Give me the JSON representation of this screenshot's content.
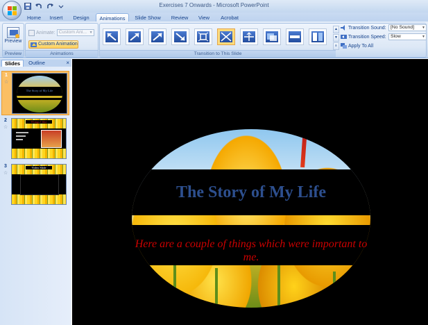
{
  "window": {
    "title": "Exercises 7 Onwards - Microsoft PowerPoint"
  },
  "tabs": [
    {
      "label": "Home",
      "active": false
    },
    {
      "label": "Insert",
      "active": false
    },
    {
      "label": "Design",
      "active": false
    },
    {
      "label": "Animations",
      "active": true
    },
    {
      "label": "Slide Show",
      "active": false
    },
    {
      "label": "Review",
      "active": false
    },
    {
      "label": "View",
      "active": false
    },
    {
      "label": "Acrobat",
      "active": false
    }
  ],
  "ribbon": {
    "preview": {
      "button_label": "Preview",
      "group_label": "Preview"
    },
    "animations": {
      "animate_label": "Animate:",
      "animate_value": "Custom Ani...",
      "custom_animation_label": "Custom Animation",
      "group_label": "Animations"
    },
    "transitions": {
      "group_label": "Transition to This Slide",
      "selected_index": 5,
      "thumb_icons": [
        "wipe-in-icon",
        "wipe-up-icon",
        "wipe-diagonal-icon",
        "push-icon",
        "box-in-icon",
        "box-out-icon",
        "split-icon",
        "cover-icon",
        "bar-icon",
        "split-vertical-icon"
      ],
      "sound_label": "Transition Sound:",
      "sound_value": "[No Sound]",
      "speed_label": "Transition Speed:",
      "speed_value": "Slow",
      "apply_all_label": "Apply To All"
    }
  },
  "left_pane": {
    "tab_slides": "Slides",
    "tab_outline": "Outline",
    "close": "×",
    "slides": [
      {
        "number": "1",
        "title": "The Story of My Life",
        "selected": true
      },
      {
        "number": "2",
        "title": "Things I like",
        "selected": false
      },
      {
        "number": "3",
        "title": "Video Slide",
        "selected": false
      }
    ]
  },
  "slide": {
    "title": "The Story of My Life",
    "subtitle": "Here are a couple of things which were important to me."
  },
  "colors": {
    "ribbon_text": "#15428b",
    "slide_title": "#2d4f8e",
    "slide_subtitle": "#cc0000",
    "selection": "#fbbf63"
  }
}
